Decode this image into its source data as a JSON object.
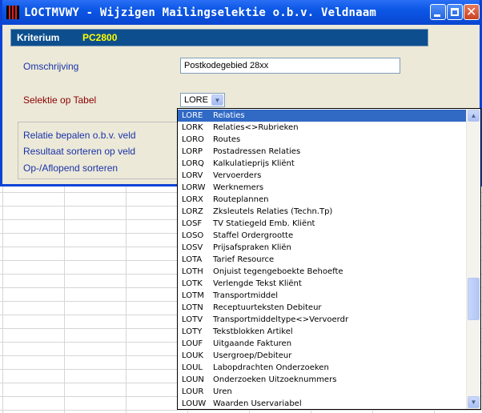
{
  "window": {
    "title": "LOCTMVWY - Wijzigen Mailingselektie o.b.v. Veldnaam",
    "controls": [
      "minimize-icon",
      "maximize-icon",
      "close-icon"
    ]
  },
  "criterium": {
    "label": "Kriterium",
    "value": "PC2800"
  },
  "form": {
    "omschrijving_label": "Omschrijving",
    "omschrijving_value": "Postkodegebied 28xx",
    "selektie_label": "Selektie op Tabel",
    "selektie_value": "LORE"
  },
  "options": {
    "relatie": "Relatie bepalen o.b.v. veld",
    "resultaat": "Resultaat sorteren op veld",
    "sorteren": "Op-/Aflopend sorteren"
  },
  "dropdown": {
    "selected_index": 0,
    "items": [
      {
        "code": "LORE",
        "desc": "Relaties"
      },
      {
        "code": "LORK",
        "desc": "Relaties<>Rubrieken"
      },
      {
        "code": "LORO",
        "desc": "Routes"
      },
      {
        "code": "LORP",
        "desc": "Postadressen Relaties"
      },
      {
        "code": "LORQ",
        "desc": "Kalkulatieprijs Kliënt"
      },
      {
        "code": "LORV",
        "desc": "Vervoerders"
      },
      {
        "code": "LORW",
        "desc": "Werknemers"
      },
      {
        "code": "LORX",
        "desc": "Routeplannen"
      },
      {
        "code": "LORZ",
        "desc": "Zksleutels Relaties (Techn.Tp)"
      },
      {
        "code": "LOSF",
        "desc": "TV Statiegeld Emb. Kliënt"
      },
      {
        "code": "LOSO",
        "desc": "Staffel Ordergrootte"
      },
      {
        "code": "LOSV",
        "desc": "Prijsafspraken Kliën"
      },
      {
        "code": "LOTA",
        "desc": "Tarief Resource"
      },
      {
        "code": "LOTH",
        "desc": "Onjuist tegengeboekte Behoefte"
      },
      {
        "code": "LOTK",
        "desc": "Verlengde Tekst Kliënt"
      },
      {
        "code": "LOTM",
        "desc": "Transportmiddel"
      },
      {
        "code": "LOTN",
        "desc": "Receptuurteksten Debiteur"
      },
      {
        "code": "LOTV",
        "desc": "Transportmiddeltype<>Vervoerdr"
      },
      {
        "code": "LOTY",
        "desc": "Tekstblokken Artikel"
      },
      {
        "code": "LOUF",
        "desc": "Uitgaande Fakturen"
      },
      {
        "code": "LOUK",
        "desc": "Usergroep/Debiteur"
      },
      {
        "code": "LOUL",
        "desc": "Labopdrachten Onderzoeken"
      },
      {
        "code": "LOUN",
        "desc": "Onderzoeken Uitzoeknummers"
      },
      {
        "code": "LOUR",
        "desc": "Uren"
      },
      {
        "code": "LOUW",
        "desc": "Waarden Uservariabel"
      }
    ]
  },
  "colors": {
    "titlebar": "#0a57e6",
    "criterium_bar": "#0d4f8e",
    "criterium_value": "#ffff00",
    "label_blue": "#1a33a8",
    "label_red": "#8b0000",
    "selection": "#316ac5"
  }
}
